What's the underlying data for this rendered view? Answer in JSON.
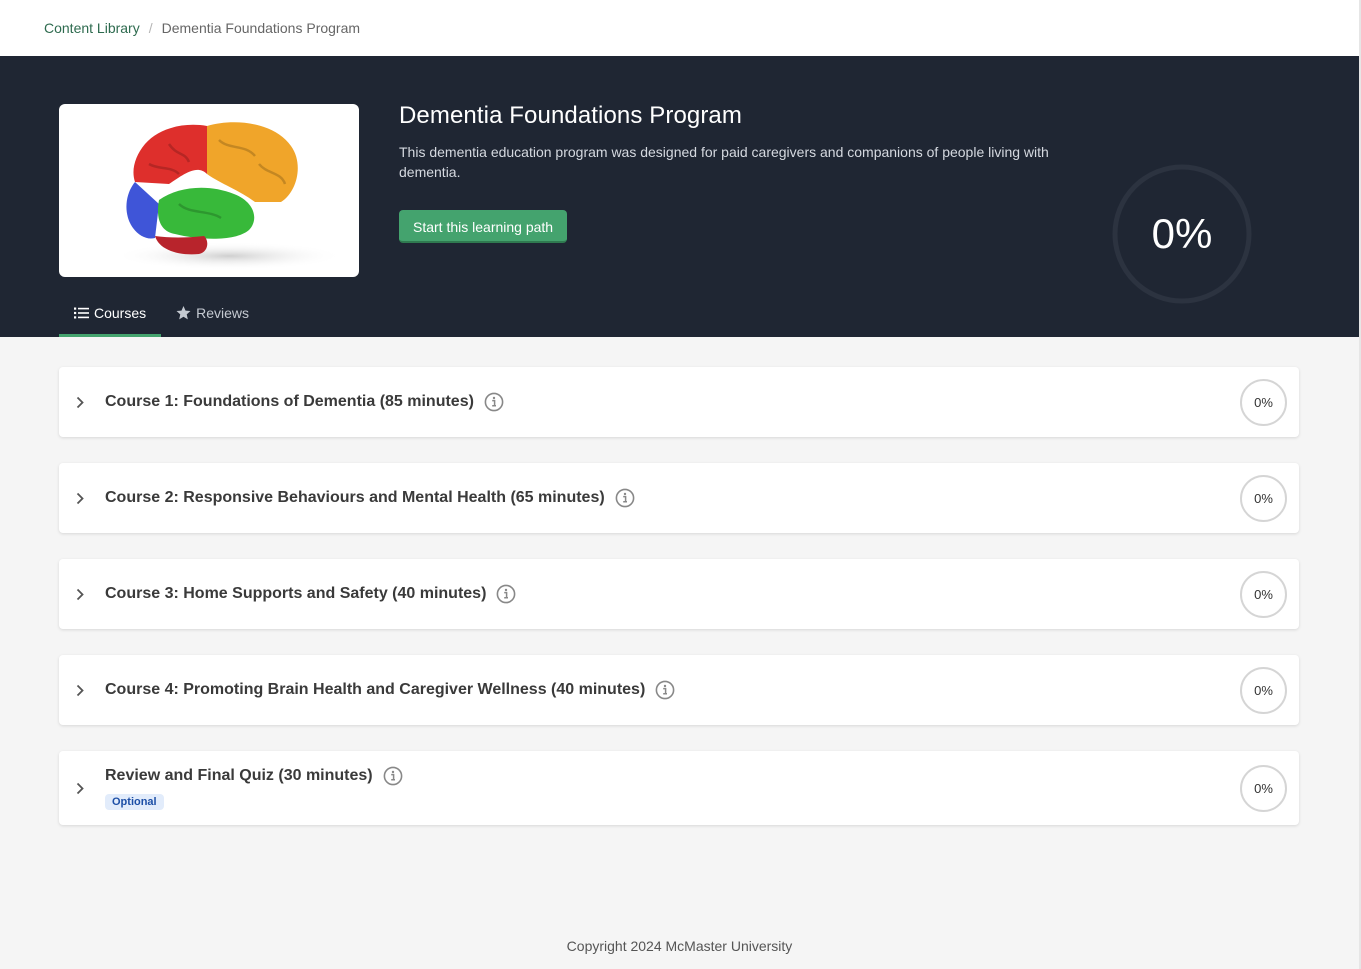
{
  "breadcrumb": {
    "root": "Content Library",
    "separator": "/",
    "current": "Dementia Foundations Program"
  },
  "hero": {
    "title": "Dementia Foundations Program",
    "description": "This dementia education program was designed for paid caregivers and companions of people living with dementia.",
    "start_button": "Start this learning path",
    "progress": "0%",
    "progress_fraction": 0,
    "image_icon": "brain-illustration"
  },
  "tabs": [
    {
      "label": "Courses",
      "icon": "list-icon",
      "active": true
    },
    {
      "label": "Reviews",
      "icon": "star-icon",
      "active": false
    }
  ],
  "courses": [
    {
      "title": "Course 1: Foundations of Dementia (85 minutes)",
      "progress": "0%"
    },
    {
      "title": "Course 2: Responsive Behaviours and Mental Health (65 minutes)",
      "progress": "0%"
    },
    {
      "title": "Course 3: Home Supports and Safety (40 minutes)",
      "progress": "0%"
    },
    {
      "title": "Course 4: Promoting Brain Health and Caregiver Wellness (40 minutes)",
      "progress": "0%"
    },
    {
      "title": "Review and Final Quiz (30 minutes)",
      "progress": "0%",
      "badge": "Optional"
    }
  ],
  "footer": {
    "copyright": "Copyright 2024 McMaster University"
  },
  "colors": {
    "hero_bg": "#1f2633",
    "accent_green": "#44a36e",
    "link_green": "#2e6b4f",
    "badge_blue": "#1d4fa6"
  }
}
